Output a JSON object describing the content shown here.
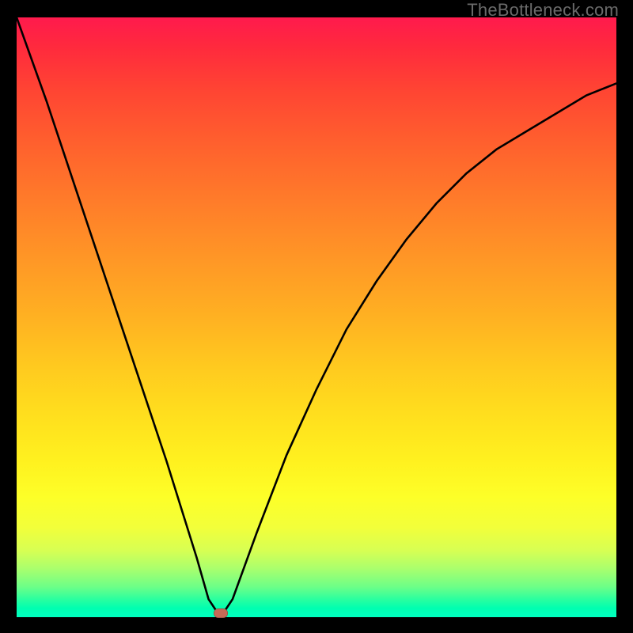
{
  "watermark": "TheBottleneck.com",
  "chart_data": {
    "type": "line",
    "title": "",
    "xlabel": "",
    "ylabel": "",
    "xlim": [
      0,
      100
    ],
    "ylim": [
      0,
      100
    ],
    "grid": false,
    "legend": false,
    "series": [
      {
        "name": "curve",
        "x": [
          0,
          5,
          10,
          15,
          20,
          25,
          30,
          32,
          34,
          36,
          40,
          45,
          50,
          55,
          60,
          65,
          70,
          75,
          80,
          85,
          90,
          95,
          100
        ],
        "y": [
          100,
          86,
          71,
          56,
          41,
          26,
          10,
          3,
          0,
          3,
          14,
          27,
          38,
          48,
          56,
          63,
          69,
          74,
          78,
          81,
          84,
          87,
          89
        ]
      }
    ],
    "background_gradient": {
      "top": "#ff1a4d",
      "mid": "#fff11f",
      "bottom": "#00ffc0"
    },
    "marker": {
      "x": 34,
      "y": 0,
      "color": "#c56a57"
    }
  }
}
